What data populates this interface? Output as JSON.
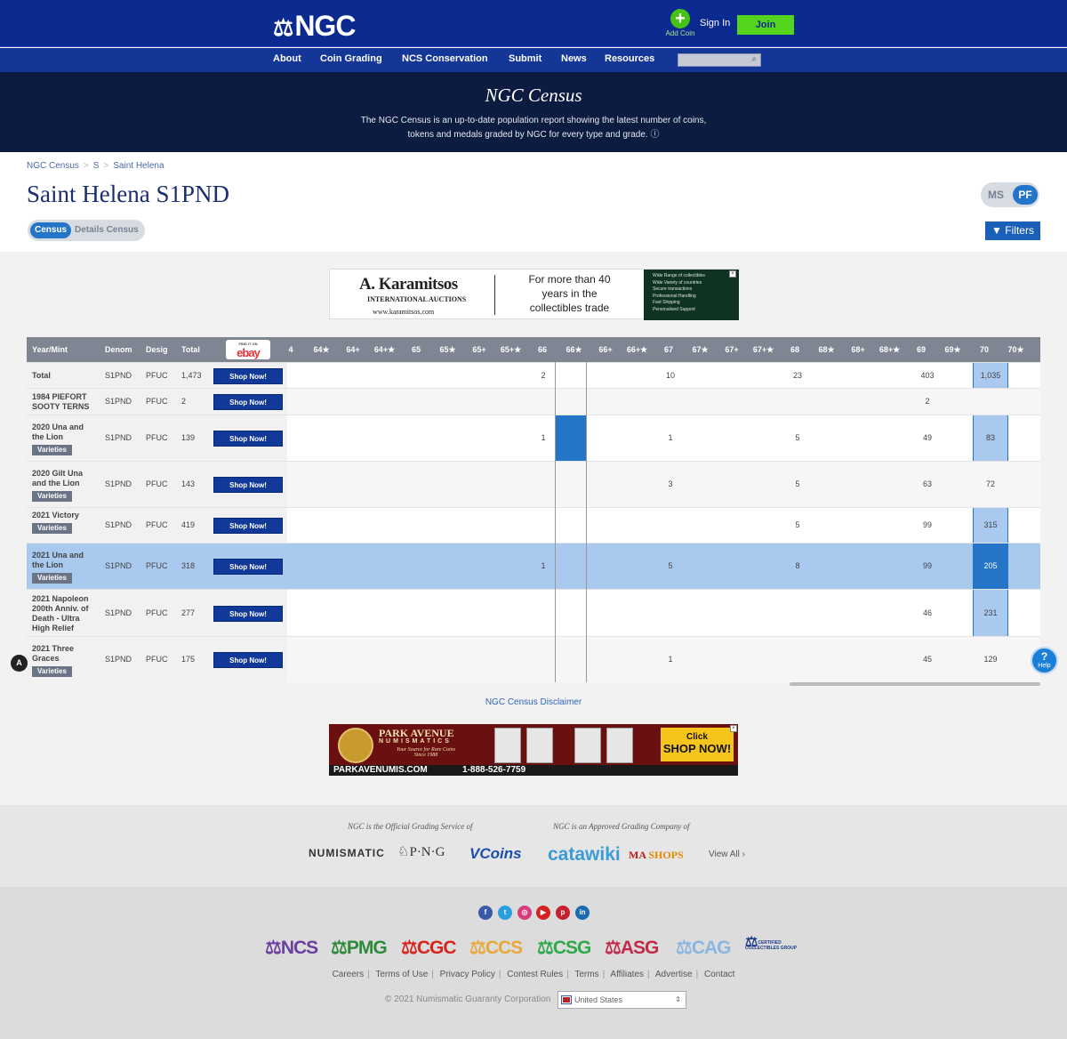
{
  "header": {
    "logo": "NGC",
    "add_coin": "Add Coin",
    "sign_in": "Sign In",
    "join": "Join",
    "nav": [
      "About",
      "Coin Grading",
      "NCS Conservation",
      "Submit",
      "News",
      "Resources"
    ],
    "search_placeholder": ""
  },
  "hero": {
    "title": "NGC Census",
    "description_line1": "The NGC Census is an up-to-date population report showing the latest number of coins,",
    "description_line2": "tokens and medals graded by NGC for every type and grade."
  },
  "breadcrumb": [
    "NGC Census",
    "S",
    "Saint Helena"
  ],
  "page_title": "Saint Helena S1PND",
  "tabs": {
    "census": "Census",
    "details": "Details Census"
  },
  "toggle": {
    "ms": "MS",
    "pf": "PF"
  },
  "filters": "Filters",
  "ad_top": {
    "brand": "A. Karamitsos",
    "sub": "INTERNATIONAL AUCTIONS",
    "url": "www.karamitsos.com",
    "tagline": "For more than 40 years in the collectibles trade",
    "bullets": [
      "Wide Range of collectibles",
      "Wide Variety of countries",
      "Secure transactions",
      "Professional Handling",
      "Fast Shipping",
      "Personalised Support"
    ]
  },
  "table": {
    "headers": {
      "year": "Year/Mint",
      "denom": "Denom",
      "desig": "Desig",
      "total": "Total",
      "ebay_find": "FIND IT ON",
      "ebay": "ebay"
    },
    "grade_headers": [
      "4",
      "64★",
      "64+",
      "64+★",
      "65",
      "65★",
      "65+",
      "65+★",
      "66",
      "66★",
      "66+",
      "66+★",
      "67",
      "67★",
      "67+",
      "67+★",
      "68",
      "68★",
      "68+",
      "68+★",
      "69",
      "69★",
      "70",
      "70★"
    ],
    "shop_label": "Shop Now!",
    "varieties_label": "Varieties",
    "rows": [
      {
        "name": "Total",
        "denom": "S1PND",
        "desig": "PFUC",
        "total": "1,473",
        "varieties": false,
        "c66": "2",
        "c67": "10",
        "c68": "23",
        "c69": "403",
        "c70": "1,035"
      },
      {
        "name": "1984 PIEFORT SOOTY TERNS",
        "denom": "S1PND",
        "desig": "PFUC",
        "total": "2",
        "varieties": false,
        "c66": "",
        "c67": "",
        "c68": "",
        "c69": "2",
        "c70": ""
      },
      {
        "name": "2020 Una and the Lion",
        "denom": "S1PND",
        "desig": "PFUC",
        "total": "139",
        "varieties": true,
        "c66": "1",
        "c67": "1",
        "c68": "5",
        "c69": "49",
        "c70": "83"
      },
      {
        "name": "2020 Gilt Una and the Lion",
        "denom": "S1PND",
        "desig": "PFUC",
        "total": "143",
        "varieties": true,
        "c66": "",
        "c67": "3",
        "c68": "5",
        "c69": "63",
        "c70": "72"
      },
      {
        "name": "2021 Victory",
        "denom": "S1PND",
        "desig": "PFUC",
        "total": "419",
        "varieties": true,
        "c66": "",
        "c67": "",
        "c68": "5",
        "c69": "99",
        "c70": "315"
      },
      {
        "name": "2021 Una and the Lion",
        "denom": "S1PND",
        "desig": "PFUC",
        "total": "318",
        "varieties": true,
        "c66": "1",
        "c67": "5",
        "c68": "8",
        "c69": "99",
        "c70": "205"
      },
      {
        "name": "2021 Napoleon 200th Anniv. of Death - Ultra High Relief",
        "denom": "S1PND",
        "desig": "PFUC",
        "total": "277",
        "varieties": false,
        "c66": "",
        "c67": "",
        "c68": "",
        "c69": "46",
        "c70": "231"
      },
      {
        "name": "2021 Three Graces",
        "denom": "S1PND",
        "desig": "PFUC",
        "total": "175",
        "varieties": true,
        "c66": "",
        "c67": "1",
        "c68": "",
        "c69": "45",
        "c70": "129"
      }
    ]
  },
  "disclaimer": "NGC Census Disclaimer",
  "ad_bottom": {
    "title": "PARK AVENUE",
    "numismatics": "NUMISMATICS",
    "slogan": "Your Source for Rare Coins",
    "since": "Since 1988",
    "url": "PARKAVENUMIS.COM",
    "phone": "1-888-526-7759",
    "click": "Click",
    "shop": "SHOP NOW!"
  },
  "partners": {
    "official": "NGC is the Official Grading Service of",
    "approved": "NGC is an Approved Grading Company of",
    "logos": [
      "NUMISMATIC",
      "P·N·G",
      "VCoins",
      "catawiki",
      "MA",
      "SHOPS"
    ],
    "view_all": "View All"
  },
  "footer": {
    "social": [
      "facebook-icon",
      "twitter-icon",
      "instagram-icon",
      "youtube-icon",
      "pinterest-icon",
      "linkedin-icon"
    ],
    "brands": [
      "NCS",
      "PMG",
      "CGC",
      "CCS",
      "CSG",
      "ASG",
      "CAG",
      "CERTIFIED COLLECTIBLES GROUP"
    ],
    "links": [
      "Careers",
      "Terms of Use",
      "Privacy Policy",
      "Contest Rules",
      "Terms",
      "Affiliates",
      "Advertise",
      "Contact"
    ],
    "copyright": "© 2021 Numismatic Guaranty Corporation",
    "country": "United States"
  },
  "help": "Help",
  "colors": {
    "navy": "#0b2a8f",
    "accent": "#2474c8",
    "join": "#54d41c",
    "hero": "#0c1b40"
  }
}
